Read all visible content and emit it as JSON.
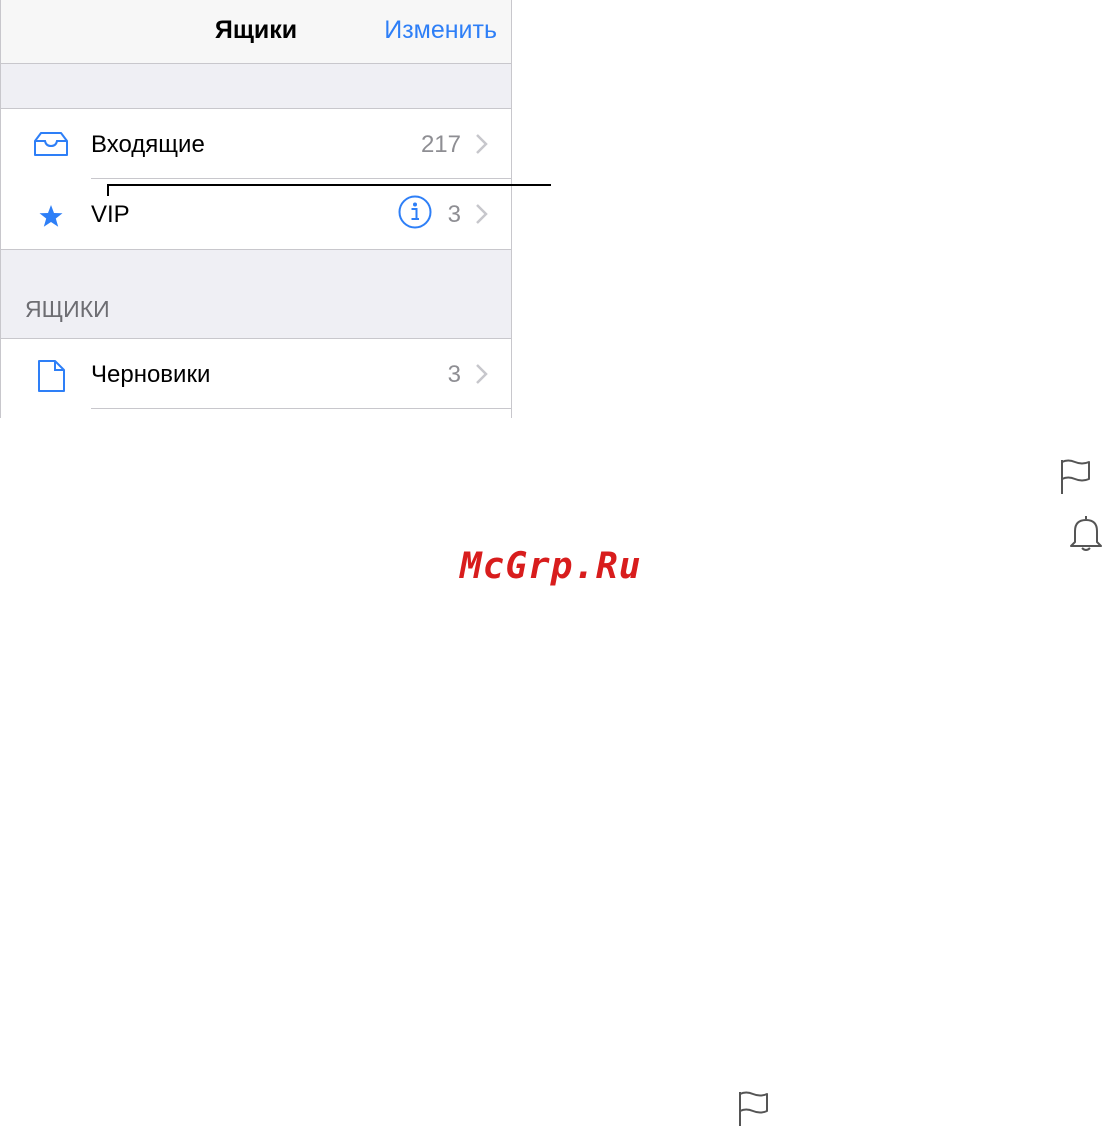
{
  "navbar": {
    "title": "Ящики",
    "edit_label": "Изменить"
  },
  "favorites": [
    {
      "icon": "inbox-tray-icon",
      "label": "Входящие",
      "count": "217"
    },
    {
      "icon": "star-icon",
      "label": "VIP",
      "count": "3"
    }
  ],
  "section_header": "ЯЩИКИ",
  "mailboxes": [
    {
      "icon": "draft-document-icon",
      "label": "Черновики",
      "count": "3"
    }
  ],
  "watermark": "McGrp.Ru",
  "colors": {
    "accent": "#2e7ff7",
    "separator": "#c8c7cc",
    "group_bg": "#efeff4",
    "secondary_text": "#8e8e93",
    "watermark": "#d81d1d"
  }
}
